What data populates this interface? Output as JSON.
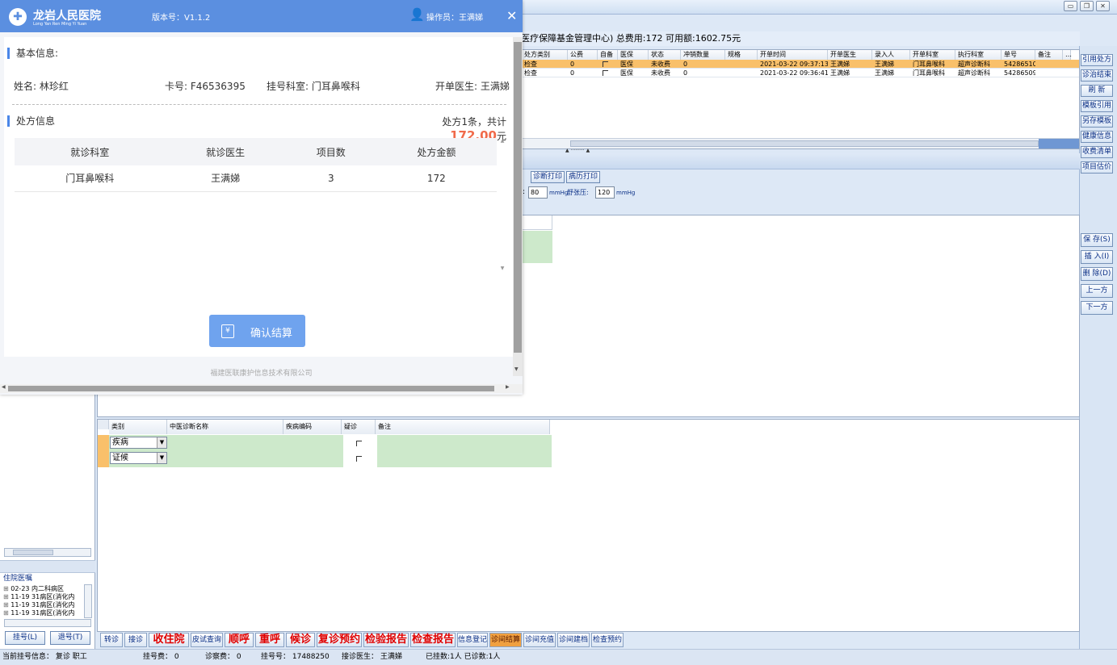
{
  "dialog": {
    "hospital_name": "龙岩人民医院",
    "hospital_pinyin": "Long Yan Ren Ming Yi Yuan",
    "version": "版本号：V1.1.2",
    "operator": "操作员：王满娣",
    "basic_info_title": "基本信息:",
    "patient_name": "姓名: 林珍红",
    "card_no": "卡号: F46536395",
    "reg_dept": "挂号科室: 门耳鼻喉科",
    "doctor": "开单医生: 王满娣",
    "rx_title": "处方信息",
    "rx_summary_prefix": "处方1条，共计",
    "rx_total": "172.00",
    "rx_summary_suffix": "元",
    "table_headers": [
      "就诊科室",
      "就诊医生",
      "项目数",
      "处方金额"
    ],
    "table_rows": [
      [
        "门耳鼻喉科",
        "王满娣",
        "3",
        "172"
      ]
    ],
    "confirm_label": "确认结算",
    "confirm_icon": "¥",
    "footer": "福建医联康护信息技术有限公司"
  },
  "main": {
    "info_bar": "医疗保障基金管理中心) 总费用:172  可用额:1602.75元",
    "rx_grid": {
      "headers": [
        "处方类别",
        "公费",
        "自备",
        "医保",
        "状态",
        "冲销数量",
        "规格",
        "开单时间",
        "开单医生",
        "录入人",
        "开单科室",
        "执行科室",
        "单号",
        "备注",
        "…"
      ],
      "rows": [
        [
          "检查",
          "0",
          "",
          "医保",
          "未收费",
          "0",
          "",
          "2021-03-22 09:37:13",
          "王满娣",
          "王满娣",
          "门耳鼻喉科",
          "超声诊断科",
          "54286510",
          ""
        ],
        [
          "检查",
          "0",
          "",
          "医保",
          "未收费",
          "0",
          "",
          "2021-03-22 09:36:41",
          "王满娣",
          "王满娣",
          "门耳鼻喉科",
          "超声诊断科",
          "54286509",
          ""
        ]
      ]
    },
    "diag_print": "诊断打印",
    "record_print": "病历打印",
    "bp_prefix": ":",
    "bp_systolic": "80",
    "bp_unit": "mmHg",
    "bp_diastolic_label": "舒张压:",
    "bp_diastolic": "120",
    "bp_unit2": "mmHg",
    "tcm_grid": {
      "headers": [
        "类别",
        "中医诊断名称",
        "疾病编码",
        "疑诊",
        "备注"
      ],
      "rows": [
        [
          "疾病"
        ],
        [
          "证候"
        ]
      ]
    }
  },
  "right_buttons_top": [
    "引用处方",
    "诊治结束",
    "刷 新",
    "模板引用",
    "另存模板",
    "健康信息",
    "收费清单",
    "项目估价"
  ],
  "right_buttons_mid": [
    "保 存(S)",
    "插 入(I)",
    "删 除(D)",
    "上一方",
    "下一方"
  ],
  "left_panel": {
    "ward_title": "住院医嘱",
    "ward_items": [
      "02-23 内二科病区",
      "11-19 31病区(消化内",
      "11-19 31病区(消化内",
      "11-19 31病区(消化内"
    ],
    "reg_button": "挂号(L)",
    "unreg_button": "退号(T)"
  },
  "bottom_buttons": [
    {
      "label": "转诊",
      "style": "normal"
    },
    {
      "label": "接诊",
      "style": "normal"
    },
    {
      "label": "收住院",
      "style": "big"
    },
    {
      "label": "皮试查询",
      "style": "normal"
    },
    {
      "label": "顺呼",
      "style": "big"
    },
    {
      "label": "重呼",
      "style": "big"
    },
    {
      "label": "候诊",
      "style": "big"
    },
    {
      "label": "复诊预约",
      "style": "big"
    },
    {
      "label": "检验报告",
      "style": "big"
    },
    {
      "label": "检查报告",
      "style": "big"
    },
    {
      "label": "信息登记",
      "style": "normal"
    },
    {
      "label": "诊间结算",
      "style": "active"
    },
    {
      "label": "诊间充值",
      "style": "normal"
    },
    {
      "label": "诊间建档",
      "style": "normal"
    },
    {
      "label": "检查预约",
      "style": "normal"
    }
  ],
  "status_bar": {
    "current": "当前挂号信息：  复诊 职工",
    "reg_fee": "挂号费：  0",
    "diag_fee": "诊察费：  0",
    "reg_no": "挂号号：  17488250",
    "doctor": "接诊医生：  王满娣",
    "counts": "已挂数:1人  已诊数:1人"
  },
  "colors": {
    "dialog_header": "#5b8fe0",
    "accent_total": "#f06a4a",
    "highlight_row": "#f9c06a",
    "grid_cell_green": "#cde9cb"
  }
}
